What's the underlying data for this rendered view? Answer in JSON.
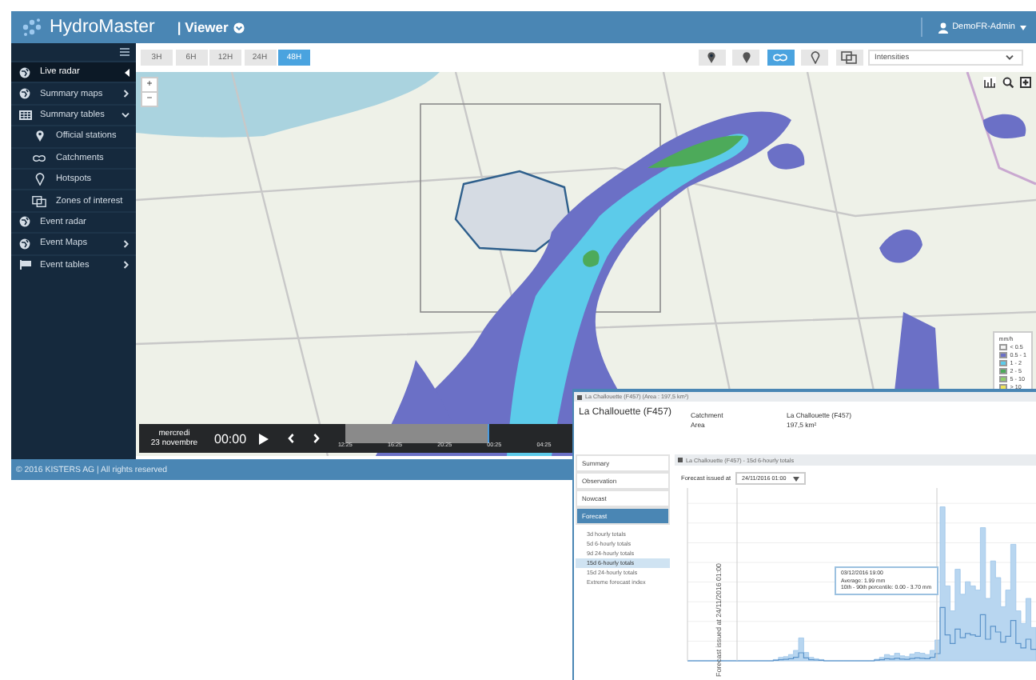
{
  "header": {
    "app_name": "HydroMaster",
    "section": "| Viewer",
    "user": "DemoFR-Admin"
  },
  "sidebar": {
    "items": [
      {
        "label": "Live radar",
        "kind": "radar",
        "selected": true
      },
      {
        "label": "Summary maps",
        "kind": "radar",
        "selected": false,
        "expanded": false
      },
      {
        "label": "Summary tables",
        "kind": "table",
        "selected": false,
        "expanded": true,
        "children": [
          {
            "label": "Official stations",
            "kind": "station",
            "selected": false
          },
          {
            "label": "Catchments",
            "kind": "catchment",
            "selected": false
          },
          {
            "label": "Hotspots",
            "kind": "hotspot",
            "selected": false
          },
          {
            "label": "Zones of interest",
            "kind": "zone",
            "selected": false
          }
        ]
      },
      {
        "label": "Event radar",
        "kind": "radar",
        "selected": false
      },
      {
        "label": "Event Maps",
        "kind": "radar",
        "selected": false,
        "expanded": false
      },
      {
        "label": "Event tables",
        "kind": "flag",
        "selected": false,
        "expanded": false
      }
    ]
  },
  "toolbar": {
    "periods": [
      {
        "label": "3H",
        "selected": false
      },
      {
        "label": "6H",
        "selected": false
      },
      {
        "label": "12H",
        "selected": false
      },
      {
        "label": "24H",
        "selected": false
      },
      {
        "label": "48H",
        "selected": true
      }
    ],
    "layer_buttons": [
      {
        "kind": "station",
        "selected": false
      },
      {
        "kind": "station-filled",
        "selected": false
      },
      {
        "kind": "catchment",
        "selected": true
      },
      {
        "kind": "hotspot",
        "selected": false
      },
      {
        "kind": "zone",
        "selected": false
      }
    ],
    "display_select": {
      "value": "Intensities"
    }
  },
  "map": {
    "zoom_in": "+",
    "zoom_out": "−",
    "legend": {
      "unit": "mm/h",
      "classes": [
        {
          "label": "< 0.5",
          "color": "#f4f4f4"
        },
        {
          "label": "0.5 - 1",
          "color": "#6b70c6"
        },
        {
          "label": "1 - 2",
          "color": "#5ccbea"
        },
        {
          "label": "2 - 5",
          "color": "#4daa5a"
        },
        {
          "label": "5 - 10",
          "color": "#8fcf6a"
        },
        {
          "label": "> 10",
          "color": "#f0e35a"
        }
      ]
    },
    "timeline": {
      "day": "mercredi",
      "date": "23 novembre",
      "time": "00:00",
      "level": 0.64,
      "ticks": [
        "12:25",
        "16:25",
        "20:25",
        "00:25",
        "04:25"
      ]
    }
  },
  "footer": "© 2016 KISTERS AG | All rights reserved",
  "popup": {
    "title": "La Challouette (F457) (Area : 197,5 km²)",
    "station_name": "La Challouette (F457)",
    "properties": [
      {
        "label": "Catchment",
        "value": "La Challouette (F457)"
      },
      {
        "label": "Area",
        "value": "197,5 km²"
      }
    ],
    "menu": [
      {
        "label": "Summary",
        "selected": false
      },
      {
        "label": "Observation",
        "selected": false
      },
      {
        "label": "Nowcast",
        "selected": false
      },
      {
        "label": "Forecast",
        "selected": true
      }
    ],
    "submenu": [
      {
        "label": "3d hourly totals",
        "selected": false
      },
      {
        "label": "5d 6-hourly totals",
        "selected": false
      },
      {
        "label": "9d 24-hourly totals",
        "selected": false
      },
      {
        "label": "15d 6-hourly totals",
        "selected": true
      },
      {
        "label": "15d 24-hourly totals",
        "selected": false
      },
      {
        "label": "Extreme forecast index",
        "selected": false
      }
    ],
    "panel_title": "La Challouette (F457) - 15d 6-hourly totals",
    "forecast_issued_label": "Forecast issued at",
    "forecast_issued_value": "24/11/2016 01:00",
    "issued_marker": "Forecast issued at 24/11/2016 01:00",
    "tooltip": {
      "time": "03/12/2016 19:00",
      "lines": [
        "Average: 1.99 mm",
        "10th - 90th percentile: 0.00 - 3.70 mm"
      ]
    }
  }
}
